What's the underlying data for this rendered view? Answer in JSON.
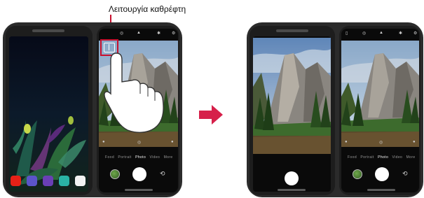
{
  "caption": "Λειτουργία καθρέφτη",
  "camera_modes": {
    "items": [
      "Food",
      "Portrait",
      "Photo",
      "Video",
      "More"
    ],
    "selected_index": 2
  },
  "colors": {
    "case": "#2b2b2b",
    "arrow": "#d6204a",
    "highlight_box": "#c8102e",
    "shutter": "#ffffff"
  },
  "icons": {
    "mirror_mode": "mirror-mode-icon",
    "arrow": "right-arrow-icon",
    "switch_camera": "switch-camera-icon",
    "gallery": "gallery-thumbnail-icon"
  }
}
